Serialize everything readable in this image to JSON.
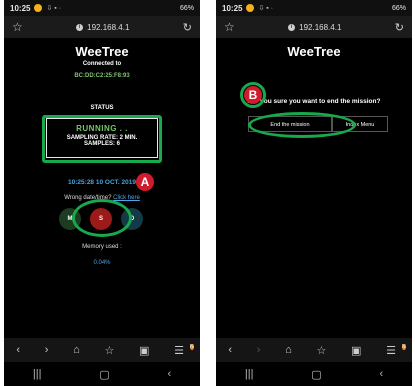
{
  "status_bar": {
    "time": "10:25",
    "left_icons": "⇩ ▪ ·",
    "battery": "66%"
  },
  "url": "192.168.4.1",
  "left": {
    "app_title": "WeeTree",
    "connected_label": "Connected to",
    "mac": "BC:DD:C2:25:F8:93",
    "status_label": "STATUS",
    "running": "RUNNING . .",
    "sampling_rate": "SAMPLING RATE: 2 MIN.",
    "samples": "SAMPLES: 6",
    "datetime": "10:25:28 10 OCT. 2019",
    "wrong_text": "Wrong date/time?",
    "click_here": "Click here",
    "btn_m": "M",
    "btn_s": "S",
    "btn_d": "D",
    "memory_label": "Memory used :",
    "memory_value": "0.04%",
    "marker": "A"
  },
  "right": {
    "app_title": "WeeTree",
    "question": "Are you sure you want to end the mission?",
    "end_button": "End the mission",
    "menu_button": "Index Menu",
    "marker": "B"
  },
  "nav_badge": "N",
  "colors": {
    "running": "#77c46c",
    "accent_blue": "#48a5de",
    "highlight_ring": "#17a94b",
    "marker": "#d11b2d"
  }
}
